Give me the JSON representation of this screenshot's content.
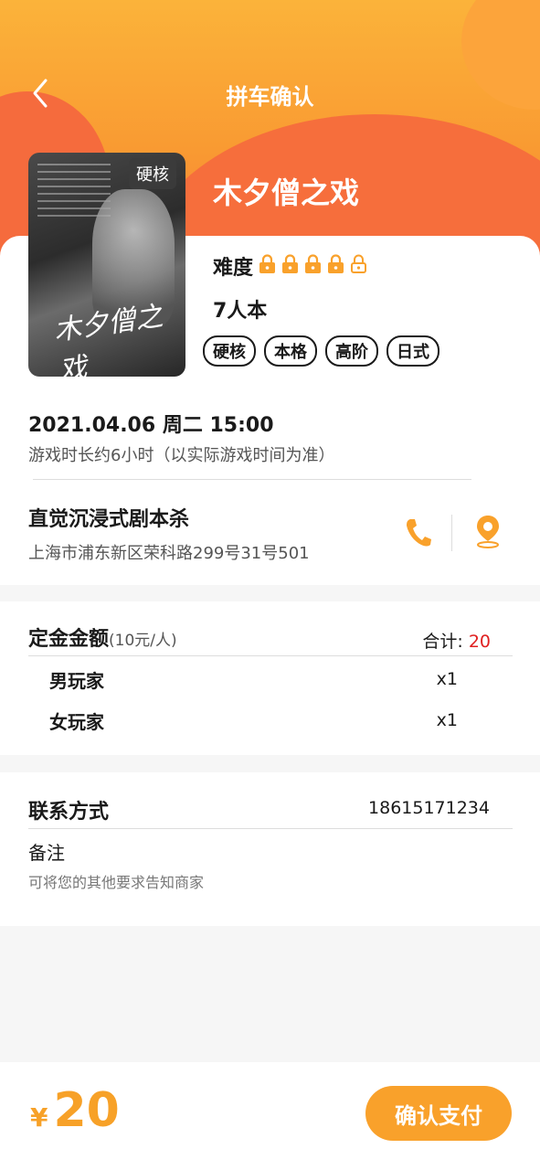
{
  "header": {
    "title": "拼车确认"
  },
  "game": {
    "name": "木夕僧之戏",
    "poster_tag": "硬核",
    "poster_text": "木夕僧之戏",
    "difficulty_label": "难度",
    "difficulty_level": 4,
    "difficulty_max": 5,
    "players": "7人本",
    "tags": [
      "硬核",
      "本格",
      "高阶",
      "日式"
    ]
  },
  "session": {
    "datetime": "2021.04.06 周二 15:00",
    "duration": "游戏时长约6小时（以实际游戏时间为准）"
  },
  "shop": {
    "name": "直觉沉浸式剧本杀",
    "address": "上海市浦东新区荣科路299号31号501"
  },
  "deposit": {
    "title": "定金金额",
    "unit": "(10元/人)",
    "total_label": "合计:",
    "total_value": "20",
    "rows": [
      {
        "label": "男玩家",
        "qty": "x1"
      },
      {
        "label": "女玩家",
        "qty": "x1"
      }
    ]
  },
  "contact": {
    "label": "联系方式",
    "phone": "18615171234",
    "remark_label": "备注",
    "remark_placeholder": "可将您的其他要求告知商家"
  },
  "footer": {
    "currency": "¥",
    "amount": "20",
    "pay_label": "确认支付"
  },
  "colors": {
    "accent": "#f9a12b",
    "total_red": "#e02020"
  },
  "icons": [
    "back-arrow-icon",
    "lock-icon",
    "unlock-icon",
    "phone-icon",
    "location-pin-icon"
  ]
}
